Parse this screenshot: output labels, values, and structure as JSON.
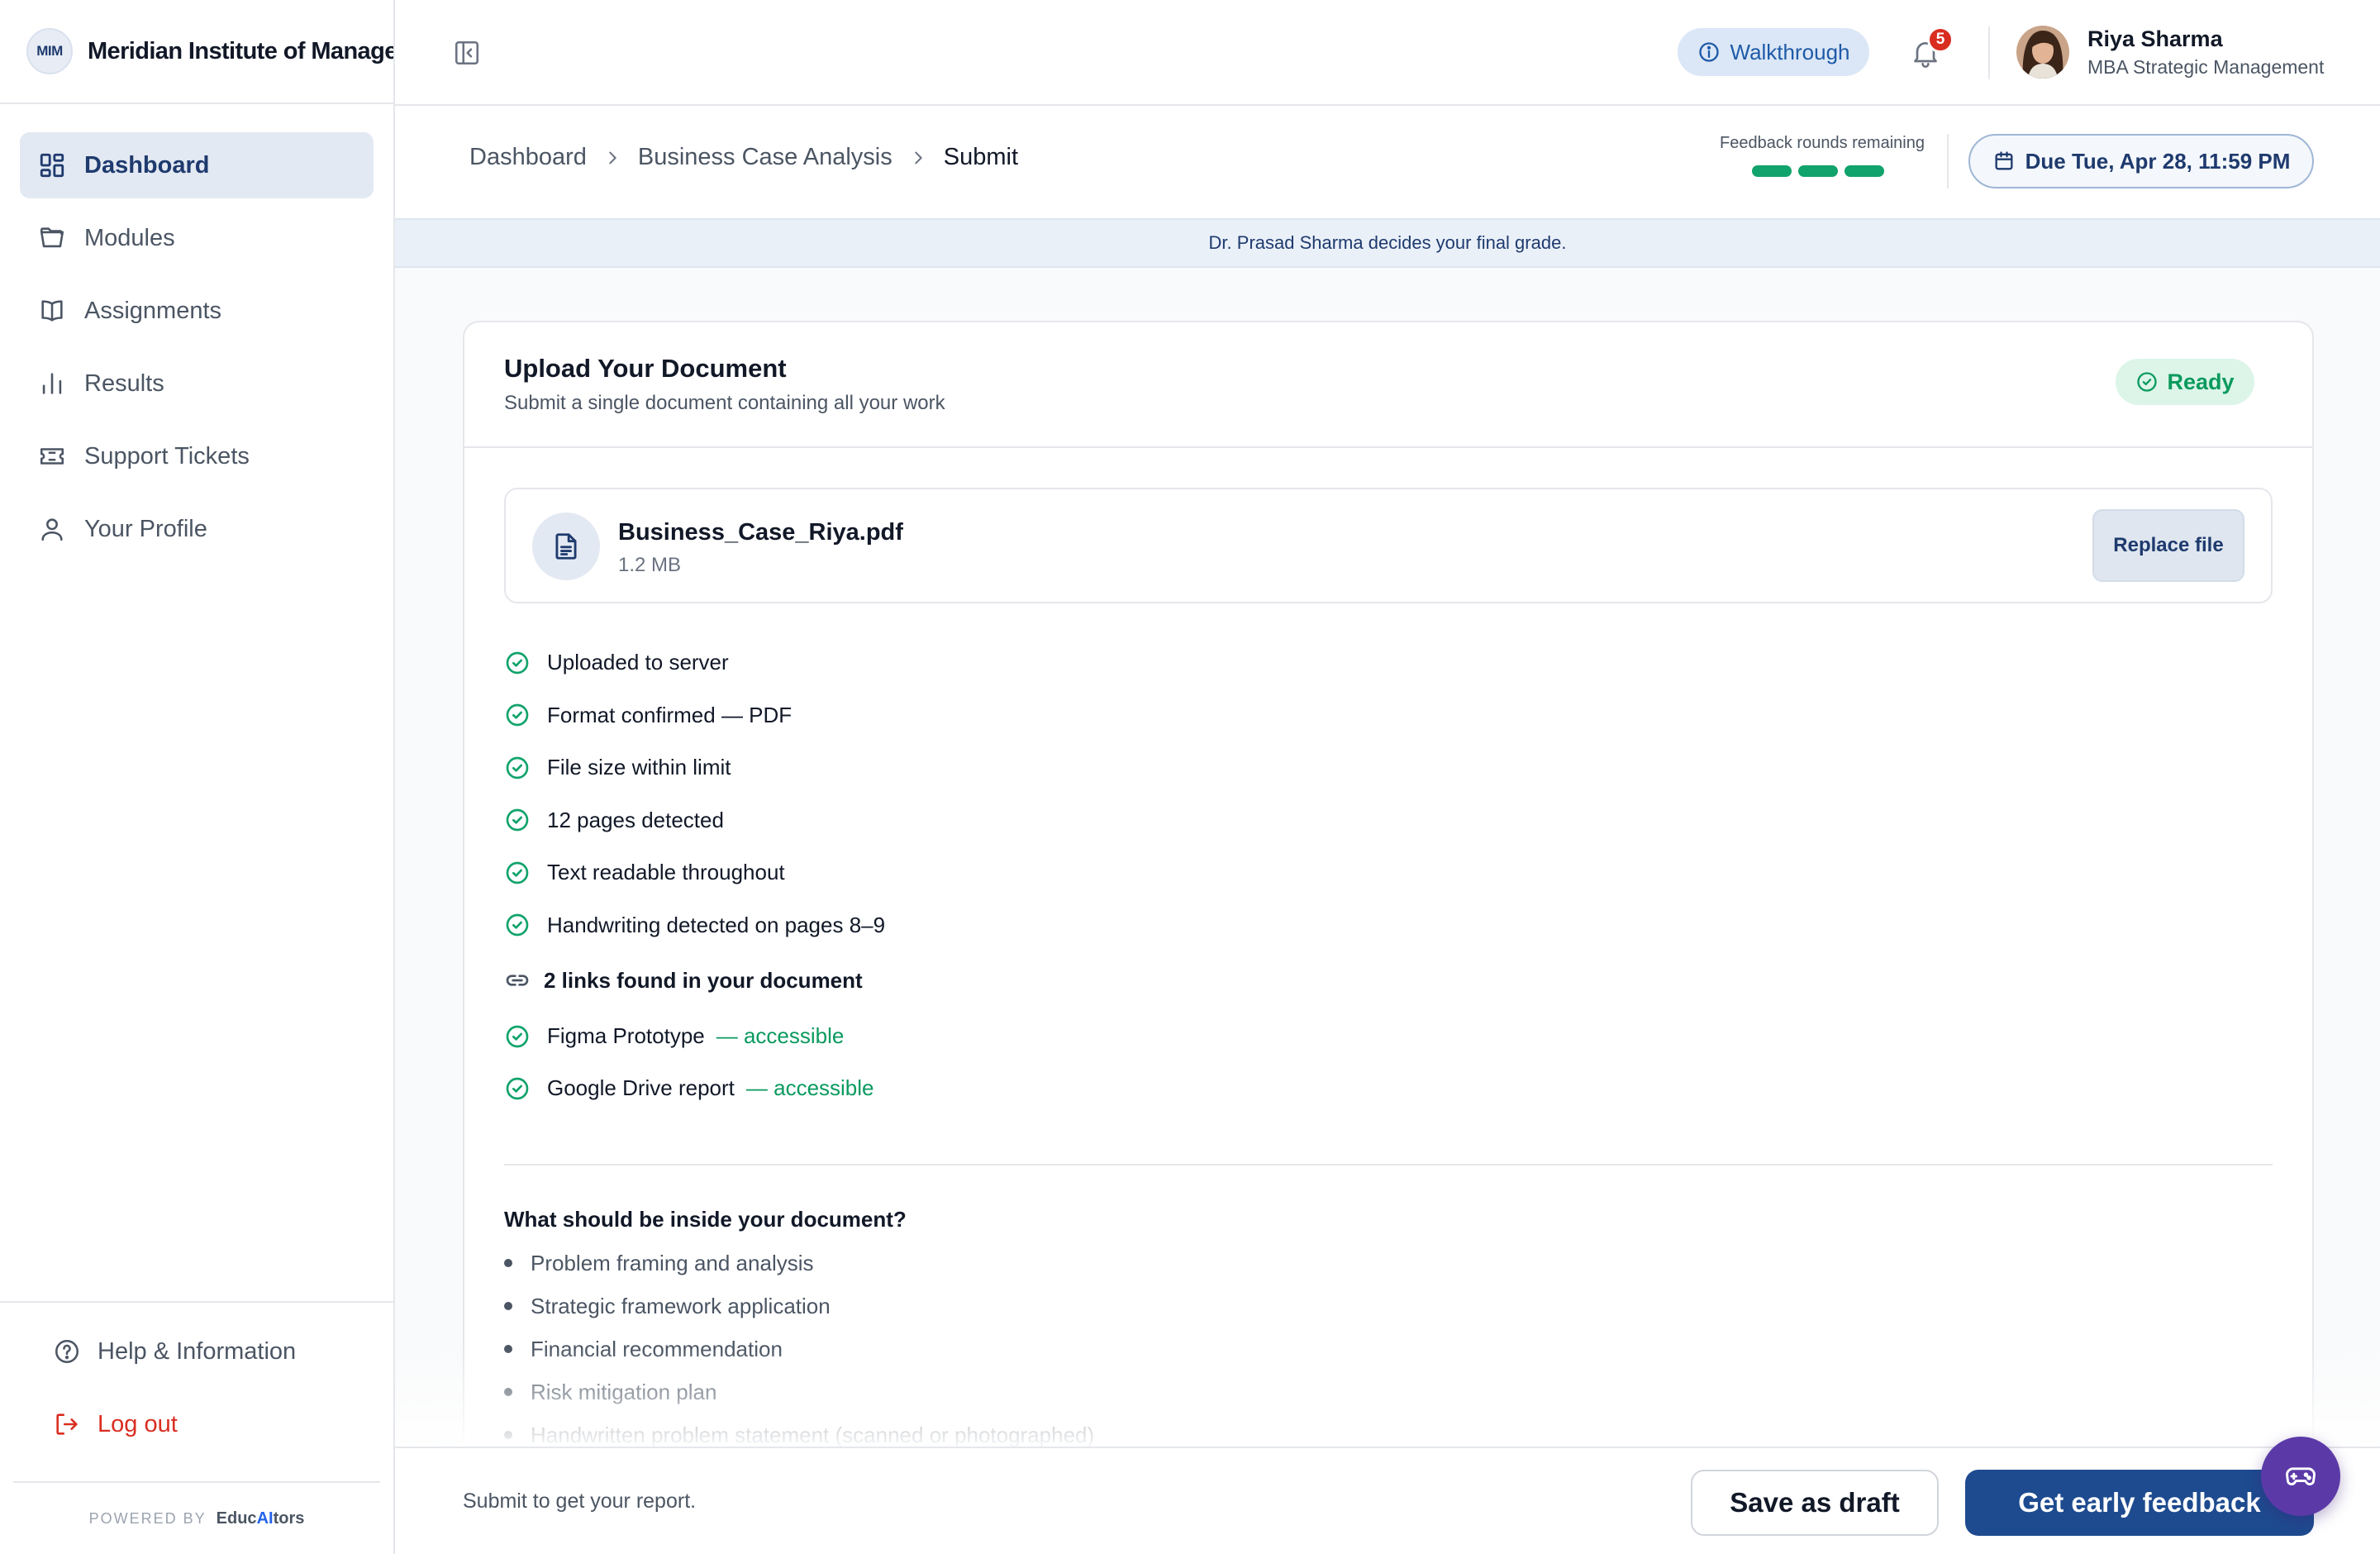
{
  "brand": {
    "logo_text": "MIM",
    "name": "Meridian Institute of Management"
  },
  "sidebar": {
    "items": [
      {
        "label": "Dashboard",
        "icon": "dashboard-icon",
        "active": true
      },
      {
        "label": "Modules",
        "icon": "folder-icon"
      },
      {
        "label": "Assignments",
        "icon": "book-icon"
      },
      {
        "label": "Results",
        "icon": "bar-chart-icon"
      },
      {
        "label": "Support Tickets",
        "icon": "ticket-icon"
      },
      {
        "label": "Your Profile",
        "icon": "user-icon"
      }
    ],
    "help_label": "Help & Information",
    "logout_label": "Log out",
    "powered_by": "POWERED BY",
    "powered_brand_a": "Educ",
    "powered_brand_b": "AI",
    "powered_brand_c": "tors"
  },
  "header": {
    "walkthrough_label": "Walkthrough",
    "notification_count": "5",
    "user_name": "Riya Sharma",
    "user_program": "MBA Strategic Management"
  },
  "breadcrumb": {
    "items": [
      "Dashboard",
      "Business Case Analysis",
      "Submit"
    ]
  },
  "feedback_rounds": {
    "label": "Feedback rounds remaining",
    "remaining": 3,
    "color": "#10a36b"
  },
  "due": {
    "label": "Due Tue, Apr 28, 11:59 PM"
  },
  "banner": {
    "text": "Dr. Prasad Sharma decides your final grade."
  },
  "upload": {
    "title": "Upload Your Document",
    "subtitle": "Submit a single document containing all your work",
    "status": "Ready",
    "file_name": "Business_Case_Riya.pdf",
    "file_size": "1.2 MB",
    "replace_label": "Replace file",
    "checks": [
      "Uploaded to server",
      "Format confirmed — PDF",
      "File size within limit",
      "12 pages detected",
      "Text readable throughout",
      "Handwriting detected on pages 8–9"
    ],
    "links_heading": "2 links found in your document",
    "links": [
      {
        "name": "Figma Prototype",
        "status": "— accessible"
      },
      {
        "name": "Google Drive report",
        "status": "— accessible"
      }
    ],
    "inside_title": "What should be inside your document?",
    "inside_items": [
      "Problem framing and analysis",
      "Strategic framework application",
      "Financial recommendation",
      "Risk mitigation plan",
      "Handwritten problem statement (scanned or photographed)"
    ]
  },
  "footer": {
    "note": "Submit to get your report.",
    "draft_label": "Save as draft",
    "feedback_label": "Get early feedback"
  },
  "colors": {
    "primary": "#1e4b8f",
    "success": "#10a36b",
    "danger": "#d92d20",
    "fab": "#5b3aa8"
  }
}
